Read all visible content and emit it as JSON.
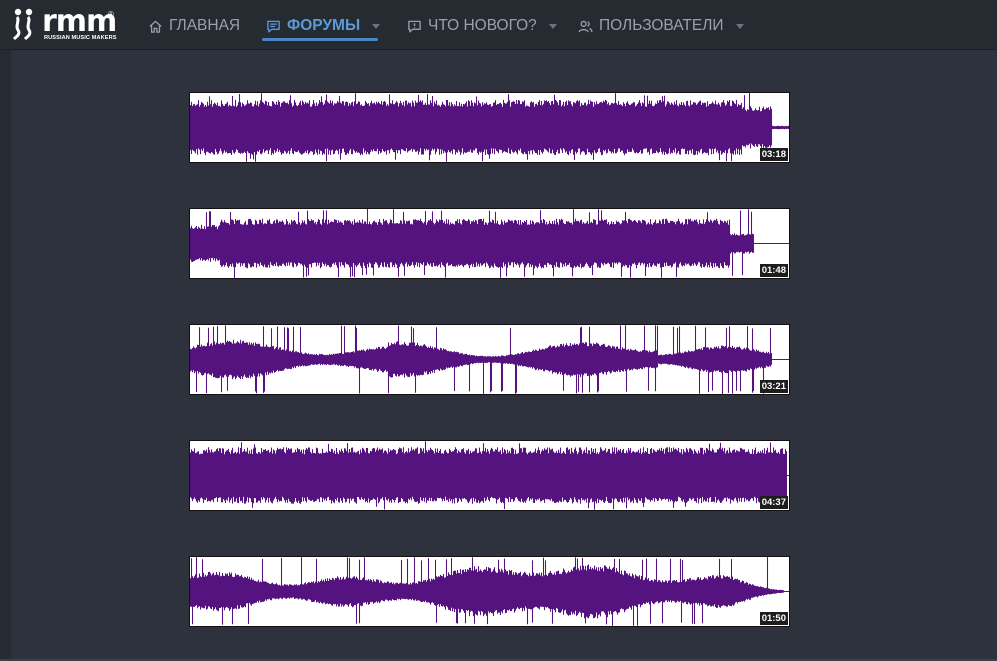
{
  "logo": {
    "wordmark": "rmm",
    "registered": "®",
    "subtitle": "RUSSIAN MUSIC MAKERS",
    "icon": "rmm-logo"
  },
  "nav": {
    "items": [
      {
        "label": "ГЛАВНАЯ",
        "icon": "home-icon",
        "active": false,
        "dropdown": false
      },
      {
        "label": "ФОРУМЫ",
        "icon": "forum-icon",
        "active": true,
        "dropdown": true
      },
      {
        "label": "ЧТО НОВОГО?",
        "icon": "whats-new-icon",
        "active": false,
        "dropdown": true
      },
      {
        "label": "ПОЛЬЗОВАТЕЛИ",
        "icon": "users-icon",
        "active": false,
        "dropdown": true
      }
    ]
  },
  "colors": {
    "background": "#2d323c",
    "topbar": "#262a31",
    "nav_text": "#9aa0ab",
    "nav_active": "#5b9bd9",
    "waveform": "#55137f"
  },
  "tracks": [
    {
      "duration": "03:18"
    },
    {
      "duration": "01:48"
    },
    {
      "duration": "03:21"
    },
    {
      "duration": "04:37"
    },
    {
      "duration": "01:50"
    }
  ]
}
